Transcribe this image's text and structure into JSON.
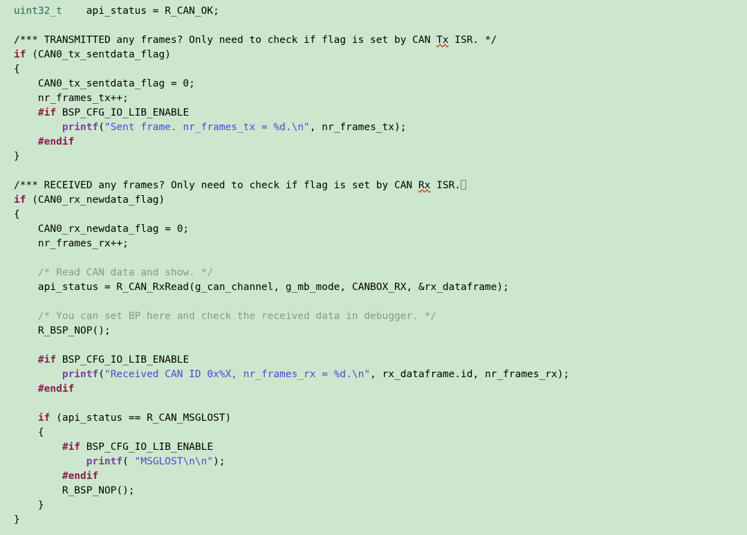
{
  "editor": {
    "language": "C",
    "background_color": "#cce7cd",
    "default_text_color": "#000000",
    "font": "monospace",
    "colors": {
      "keyword": "#8b1a4a",
      "preprocessor": "#8b1a4a",
      "type": "#26655c",
      "function": "#7c3aad",
      "string": "#4a49d6",
      "comment": "#7f9e84",
      "doc_comment": "#6a7fc4",
      "spellcheck_underline": "#d03a2a"
    }
  },
  "code": {
    "lines": [
      {
        "n": 1,
        "indent": 0,
        "segs": [
          {
            "t": "type",
            "v": "uint32_t"
          },
          {
            "t": "plain",
            "v": "    api_status = R_CAN_OK;"
          }
        ]
      },
      {
        "n": 2,
        "indent": 0,
        "segs": []
      },
      {
        "n": 3,
        "indent": 0,
        "segs": [
          {
            "t": "doccom",
            "v": "/*** TRANSMITTED any frames? Only need to check if flag is set by CAN "
          },
          {
            "t": "doccom-misspelled",
            "v": "Tx"
          },
          {
            "t": "doccom",
            "v": " ISR. */"
          }
        ]
      },
      {
        "n": 4,
        "indent": 0,
        "segs": [
          {
            "t": "keyword",
            "v": "if"
          },
          {
            "t": "plain",
            "v": " (CAN0_tx_sentdata_flag)"
          }
        ]
      },
      {
        "n": 5,
        "indent": 0,
        "segs": [
          {
            "t": "plain",
            "v": "{"
          }
        ]
      },
      {
        "n": 6,
        "indent": 1,
        "segs": [
          {
            "t": "plain",
            "v": "CAN0_tx_sentdata_flag = 0;"
          }
        ]
      },
      {
        "n": 7,
        "indent": 1,
        "segs": [
          {
            "t": "plain",
            "v": "nr_frames_tx++;"
          }
        ]
      },
      {
        "n": 8,
        "indent": 1,
        "segs": [
          {
            "t": "pp",
            "v": "#if"
          },
          {
            "t": "plain",
            "v": " BSP_CFG_IO_LIB_ENABLE"
          }
        ]
      },
      {
        "n": 9,
        "indent": 2,
        "segs": [
          {
            "t": "func",
            "v": "printf"
          },
          {
            "t": "plain",
            "v": "("
          },
          {
            "t": "string",
            "v": "\"Sent frame. nr_frames_tx = %d.\\n\""
          },
          {
            "t": "plain",
            "v": ", nr_frames_tx);"
          }
        ]
      },
      {
        "n": 10,
        "indent": 1,
        "segs": [
          {
            "t": "pp",
            "v": "#endif"
          }
        ]
      },
      {
        "n": 11,
        "indent": 0,
        "segs": [
          {
            "t": "plain",
            "v": "}"
          }
        ]
      },
      {
        "n": 12,
        "indent": 0,
        "segs": []
      },
      {
        "n": 13,
        "indent": 0,
        "segs": [
          {
            "t": "doccom",
            "v": "/*** RECEIVED any frames? Only need to check if flag is set by CAN "
          },
          {
            "t": "doccom-misspelled",
            "v": "Rx"
          },
          {
            "t": "doccom",
            "v": " ISR."
          },
          {
            "t": "tofu",
            "v": ""
          }
        ]
      },
      {
        "n": 14,
        "indent": 0,
        "segs": [
          {
            "t": "keyword",
            "v": "if"
          },
          {
            "t": "plain",
            "v": " (CAN0_rx_newdata_flag)"
          }
        ]
      },
      {
        "n": 15,
        "indent": 0,
        "segs": [
          {
            "t": "plain",
            "v": "{"
          }
        ]
      },
      {
        "n": 16,
        "indent": 1,
        "segs": [
          {
            "t": "plain",
            "v": "CAN0_rx_newdata_flag = 0;"
          }
        ]
      },
      {
        "n": 17,
        "indent": 1,
        "segs": [
          {
            "t": "plain",
            "v": "nr_frames_rx++;"
          }
        ]
      },
      {
        "n": 18,
        "indent": 0,
        "segs": []
      },
      {
        "n": 19,
        "indent": 1,
        "segs": [
          {
            "t": "comment",
            "v": "/* Read CAN data and show. */"
          }
        ]
      },
      {
        "n": 20,
        "indent": 1,
        "segs": [
          {
            "t": "plain",
            "v": "api_status = R_CAN_RxRead(g_can_channel, g_mb_mode, CANBOX_RX, &rx_dataframe);"
          }
        ]
      },
      {
        "n": 21,
        "indent": 0,
        "segs": []
      },
      {
        "n": 22,
        "indent": 1,
        "segs": [
          {
            "t": "comment",
            "v": "/* You can set BP here and check the received data in debugger. */"
          }
        ]
      },
      {
        "n": 23,
        "indent": 1,
        "segs": [
          {
            "t": "plain",
            "v": "R_BSP_NOP();"
          }
        ]
      },
      {
        "n": 24,
        "indent": 0,
        "segs": []
      },
      {
        "n": 25,
        "indent": 1,
        "segs": [
          {
            "t": "pp",
            "v": "#if"
          },
          {
            "t": "plain",
            "v": " BSP_CFG_IO_LIB_ENABLE"
          }
        ]
      },
      {
        "n": 26,
        "indent": 2,
        "segs": [
          {
            "t": "func",
            "v": "printf"
          },
          {
            "t": "plain",
            "v": "("
          },
          {
            "t": "string",
            "v": "\"Received CAN ID 0x%X, nr_frames_rx = %d.\\n\""
          },
          {
            "t": "plain",
            "v": ", rx_dataframe.id, nr_frames_rx);"
          }
        ]
      },
      {
        "n": 27,
        "indent": 1,
        "segs": [
          {
            "t": "pp",
            "v": "#endif"
          }
        ]
      },
      {
        "n": 28,
        "indent": 0,
        "segs": []
      },
      {
        "n": 29,
        "indent": 1,
        "segs": [
          {
            "t": "keyword",
            "v": "if"
          },
          {
            "t": "plain",
            "v": " (api_status == R_CAN_MSGLOST)"
          }
        ]
      },
      {
        "n": 30,
        "indent": 1,
        "segs": [
          {
            "t": "plain",
            "v": "{"
          }
        ]
      },
      {
        "n": 31,
        "indent": 2,
        "segs": [
          {
            "t": "pp",
            "v": "#if"
          },
          {
            "t": "plain",
            "v": " BSP_CFG_IO_LIB_ENABLE"
          }
        ]
      },
      {
        "n": 32,
        "indent": 3,
        "segs": [
          {
            "t": "func",
            "v": "printf"
          },
          {
            "t": "plain",
            "v": "( "
          },
          {
            "t": "string",
            "v": "\"MSGLOST\\n\\n\""
          },
          {
            "t": "plain",
            "v": ");"
          }
        ]
      },
      {
        "n": 33,
        "indent": 2,
        "segs": [
          {
            "t": "pp",
            "v": "#endif"
          }
        ]
      },
      {
        "n": 34,
        "indent": 2,
        "segs": [
          {
            "t": "plain",
            "v": "R_BSP_NOP();"
          }
        ]
      },
      {
        "n": 35,
        "indent": 1,
        "segs": [
          {
            "t": "plain",
            "v": "}"
          }
        ]
      },
      {
        "n": 36,
        "indent": 0,
        "segs": [
          {
            "t": "plain",
            "v": "}"
          }
        ]
      }
    ]
  }
}
